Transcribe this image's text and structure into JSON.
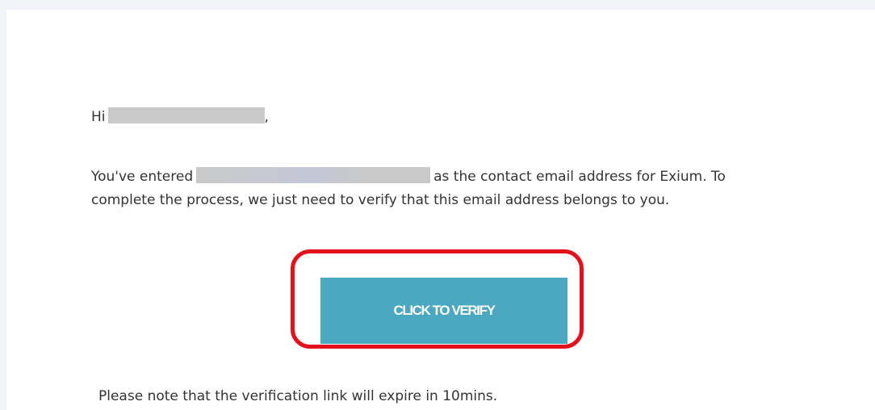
{
  "email": {
    "greeting_prefix": "Hi",
    "greeting_suffix": ",",
    "intro_before": "You've entered",
    "intro_after": "as the contact email address for Exium. To complete the process, we just need to verify that this email address belongs to you.",
    "verify_button_label": "CLICK TO VERIFY",
    "expiry_note": "Please note that the verification link will expire in 10mins."
  },
  "colors": {
    "button": "#4ca8bf",
    "highlight": "#e3111b",
    "redaction": "#c9c9c9"
  }
}
